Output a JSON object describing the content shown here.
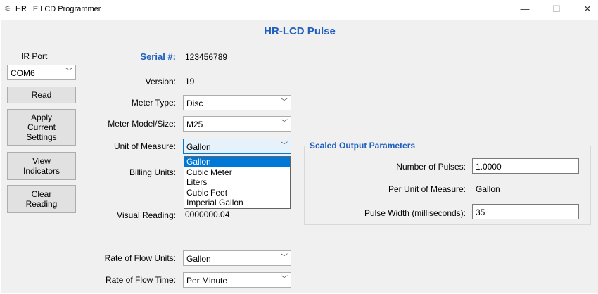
{
  "window": {
    "title": "HR | E LCD Programmer",
    "controls": {
      "minimize": "—",
      "maximize": "☐",
      "close": "✕"
    },
    "app_icon": "⚟"
  },
  "header": {
    "title": "HR-LCD Pulse"
  },
  "sidebar": {
    "ir_port_label": "IR Port",
    "ir_port_value": "COM6",
    "buttons": {
      "read": "Read",
      "apply": [
        "Apply",
        "Current",
        "Settings"
      ],
      "view": [
        "View",
        "Indicators"
      ],
      "clear": [
        "Clear",
        "Reading"
      ]
    }
  },
  "info": {
    "serial_label": "Serial #:",
    "serial_value": "123456789",
    "version_label": "Version:",
    "version_value": "19"
  },
  "fields": {
    "meter_type_label": "Meter Type:",
    "meter_type_value": "Disc",
    "meter_model_label": "Meter Model/Size:",
    "meter_model_value": "M25",
    "unit_label": "Unit of Measure:",
    "unit_value": "Gallon",
    "billing_label": "Billing Units:",
    "visual_label": "Visual Reading:",
    "visual_value": "0000000.04",
    "rate_units_label": "Rate of Flow Units:",
    "rate_units_value": "Gallon",
    "rate_time_label": "Rate of Flow Time:",
    "rate_time_value": "Per Minute"
  },
  "unit_dropdown": {
    "options": [
      "Gallon",
      "Cubic Meter",
      "Liters",
      "Cubic Feet",
      "Imperial Gallon"
    ],
    "selected_index": 0
  },
  "scaled": {
    "title": "Scaled Output Parameters",
    "pulses_label": "Number of Pulses:",
    "pulses_value": "1.0000",
    "per_unit_label": "Per Unit of Measure:",
    "per_unit_value": "Gallon",
    "width_label": "Pulse Width (milliseconds):",
    "width_value": "35"
  },
  "icons": {
    "chevron": "chevron-down-icon"
  },
  "colors": {
    "accent": "#1f5fbf",
    "selection": "#0078d7",
    "background": "#f0f0f0"
  }
}
